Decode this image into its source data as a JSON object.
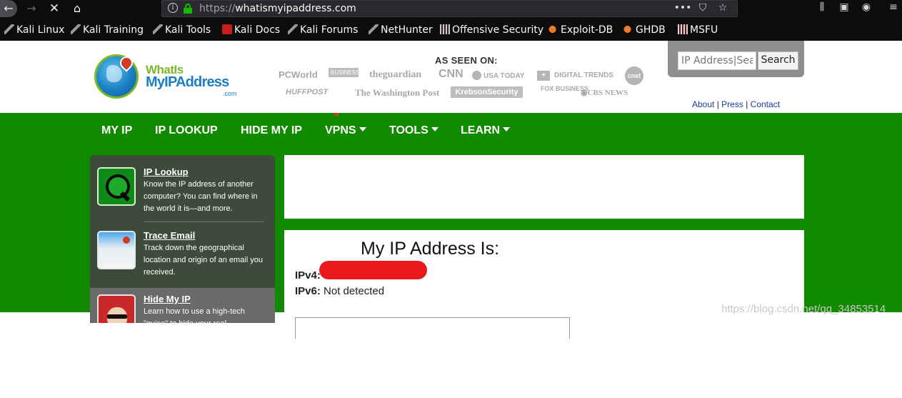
{
  "browser": {
    "url_protocol": "https://",
    "url_host": "whatismyipaddress.com",
    "url_actions": [
      "•••",
      "pocket",
      "star"
    ],
    "bookmarks": [
      {
        "label": "Kali Linux",
        "icon": "kali-dragon-icon"
      },
      {
        "label": "Kali Training",
        "icon": "kali-dragon-icon"
      },
      {
        "label": "Kali Tools",
        "icon": "kali-dragon-icon"
      },
      {
        "label": "Kali Docs",
        "icon": "kali-docs-icon"
      },
      {
        "label": "Kali Forums",
        "icon": "kali-dragon-icon"
      },
      {
        "label": "NetHunter",
        "icon": "kali-dragon-icon"
      },
      {
        "label": "Offensive Security",
        "icon": "offsec-icon"
      },
      {
        "label": "Exploit-DB",
        "icon": "exploit-db-icon"
      },
      {
        "label": "GHDB",
        "icon": "exploit-db-icon"
      },
      {
        "label": "MSFU",
        "icon": "offsec-icon"
      }
    ]
  },
  "header": {
    "logo": {
      "line1": "WhatIs",
      "line2": "MyIPAddress",
      "suffix": ".com"
    },
    "as_seen_on": "AS SEEN ON:",
    "media": {
      "pcworld": "PCWorld",
      "business_insider": "BUSINESS INSIDER",
      "guardian": "theguardian",
      "cnn": "CNN",
      "usatoday": "USA TODAY",
      "digital_trends": "DIGITAL TRENDS",
      "cnet": "cnet",
      "huffpost": "HUFFPOST",
      "wapo": "The Washington Post",
      "krebs": "KrebsonSecurity",
      "fox": "FOX BUSINESS",
      "cbs": "CBS NEWS"
    },
    "search": {
      "placeholder": "IP Address|Sea",
      "button": "Search"
    },
    "links": {
      "about": "About",
      "press": "Press",
      "contact": "Contact",
      "sep": "|"
    }
  },
  "nav": {
    "items": [
      {
        "label": "MY IP",
        "dropdown": false
      },
      {
        "label": "IP LOOKUP",
        "dropdown": false
      },
      {
        "label": "HIDE MY IP",
        "dropdown": false
      },
      {
        "label": "VPNS",
        "dropdown": true
      },
      {
        "label": "TOOLS",
        "dropdown": true
      },
      {
        "label": "LEARN",
        "dropdown": true
      }
    ]
  },
  "sidebar": {
    "items": [
      {
        "title": "IP Lookup",
        "desc": "Know the IP address of another computer? You can find where in the world it is—and more."
      },
      {
        "title": "Trace Email",
        "desc": "Track down the geographical location and origin of an email you received."
      },
      {
        "title": "Hide My IP",
        "desc": "Learn how to use a high-tech \"guise\" to hide your real"
      }
    ]
  },
  "main": {
    "title": "My IP Address Is:",
    "ipv4_label": "IPv4:",
    "ipv4_value": "",
    "ipv6_label": "IPv6:",
    "ipv6_value": "Not detected"
  },
  "watermark": "https://blog.csdn.net/qq_34853514",
  "colors": {
    "nav_green": "#128a00",
    "redaction": "#e8181c",
    "sidebar": "#3d4c3a"
  }
}
